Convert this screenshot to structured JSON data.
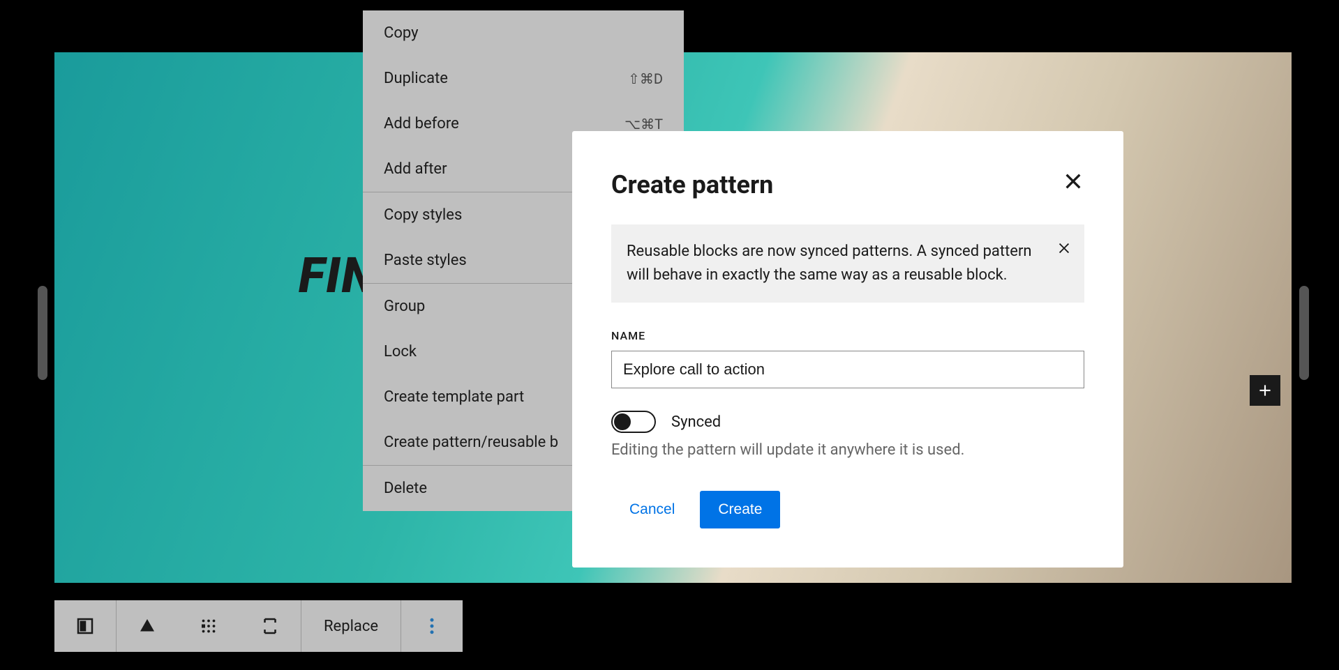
{
  "canvas": {
    "heading_fragment": "FIN"
  },
  "toolbar": {
    "replace_label": "Replace"
  },
  "context_menu": {
    "sections": [
      [
        {
          "label": "Copy",
          "shortcut": ""
        },
        {
          "label": "Duplicate",
          "shortcut": "⇧⌘D"
        },
        {
          "label": "Add before",
          "shortcut": "⌥⌘T"
        },
        {
          "label": "Add after",
          "shortcut": ""
        }
      ],
      [
        {
          "label": "Copy styles",
          "shortcut": ""
        },
        {
          "label": "Paste styles",
          "shortcut": ""
        }
      ],
      [
        {
          "label": "Group",
          "shortcut": ""
        },
        {
          "label": "Lock",
          "shortcut": ""
        },
        {
          "label": "Create template part",
          "shortcut": ""
        },
        {
          "label": "Create pattern/reusable b",
          "shortcut": ""
        }
      ],
      [
        {
          "label": "Delete",
          "shortcut": ""
        }
      ]
    ]
  },
  "modal": {
    "title": "Create pattern",
    "notice": "Reusable blocks are now synced patterns. A synced pattern will behave in exactly the same way as a reusable block.",
    "name_label": "NAME",
    "name_value": "Explore call to action",
    "synced_label": "Synced",
    "synced_help": "Editing the pattern will update it anywhere it is used.",
    "cancel_label": "Cancel",
    "create_label": "Create"
  }
}
